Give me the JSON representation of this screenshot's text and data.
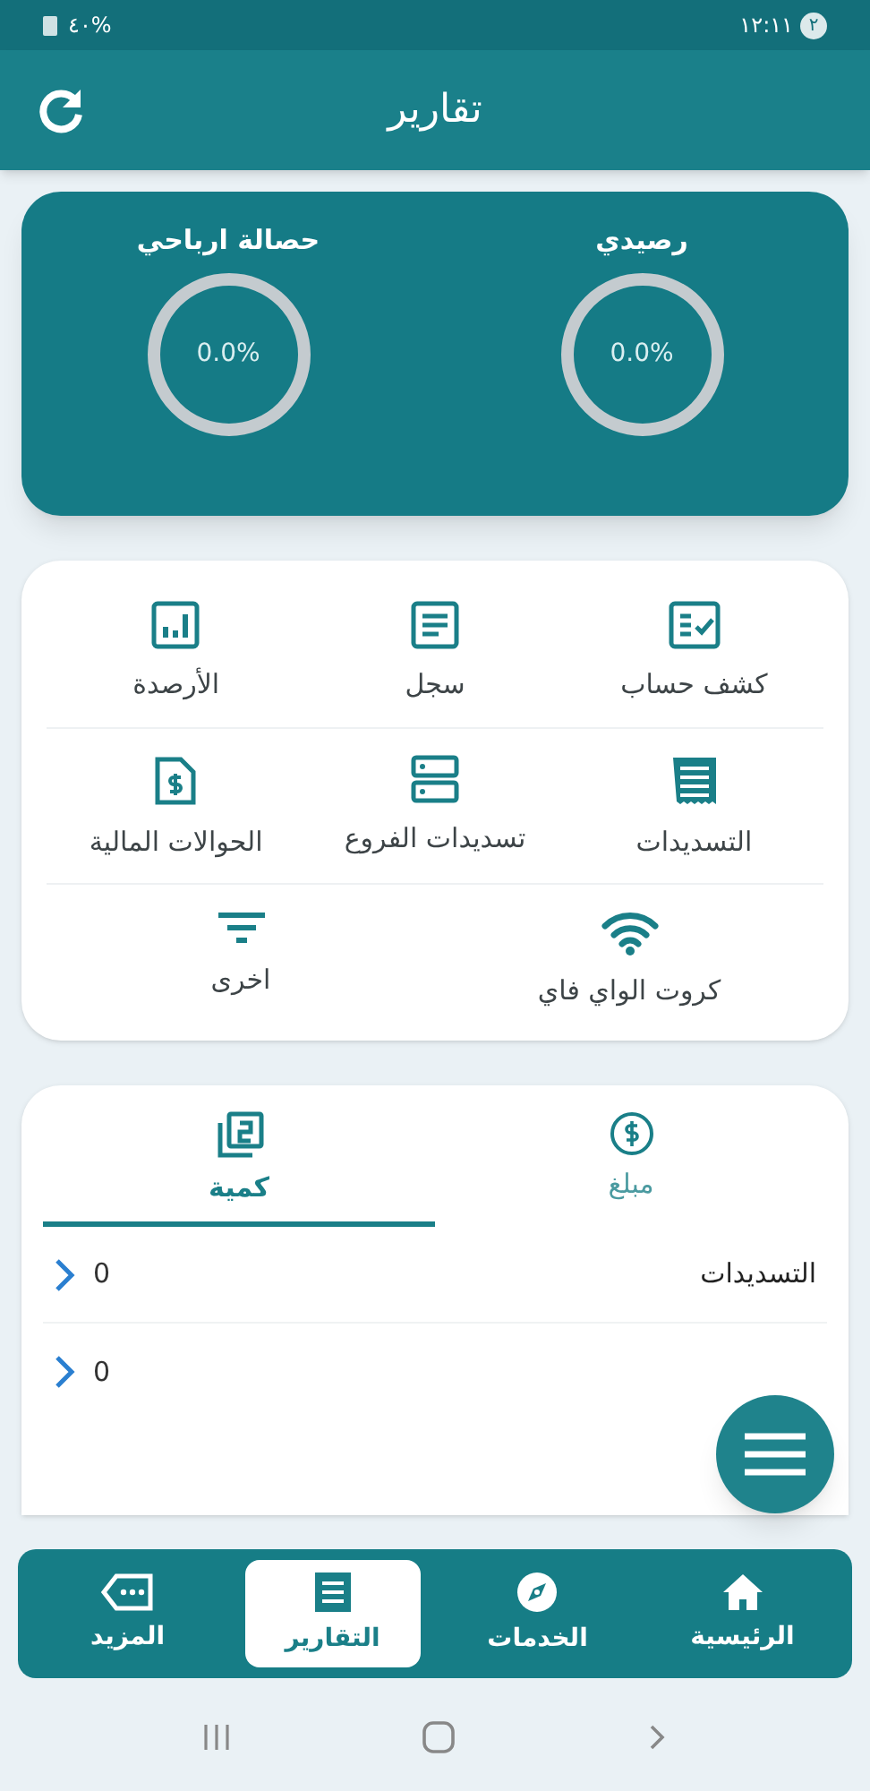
{
  "status_bar": {
    "time": "١٢:١١",
    "notification_count": "٢",
    "battery": "%٤٠"
  },
  "header": {
    "title": "تقارير"
  },
  "gauges": [
    {
      "label": "رصيدي",
      "reading": "0.0%",
      "level": 0
    },
    {
      "label": "حصالة ارباحي",
      "reading": "0.0%",
      "level": 0
    }
  ],
  "report_grid": [
    [
      {
        "label": "كشف حساب"
      },
      {
        "label": "سجل"
      },
      {
        "label": "الأرصدة"
      }
    ],
    [
      {
        "label": "التسديدات"
      },
      {
        "label": "تسديدات الفروع"
      },
      {
        "label": "الحوالات المالية"
      }
    ],
    [
      {
        "label": "كروت الواي فاي"
      },
      {
        "label": "اخرى"
      }
    ]
  ],
  "summary_tabs": [
    {
      "label": "مبلغ",
      "selected": false
    },
    {
      "label": "كمية",
      "selected": true
    }
  ],
  "summary_rows": [
    {
      "label": "التسديدات",
      "value": "0"
    },
    {
      "value": "0"
    }
  ],
  "bottom_nav": [
    {
      "label": "الرئيسية",
      "selected": false
    },
    {
      "label": "الخدمات",
      "selected": false
    },
    {
      "label": "التقارير",
      "selected": true
    },
    {
      "label": "المزيد",
      "selected": false
    }
  ]
}
